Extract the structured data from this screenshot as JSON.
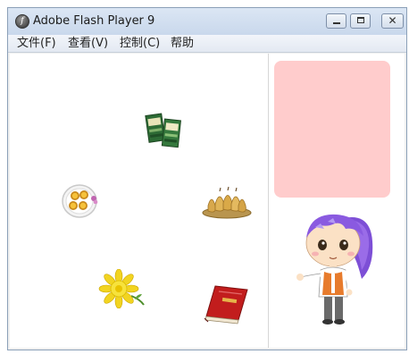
{
  "window": {
    "title": "Adobe Flash Player 9",
    "controls": {
      "minimize_icon": "minimize-icon",
      "maximize_icon": "maximize-icon",
      "close_icon": "close-icon"
    }
  },
  "menu": {
    "items": [
      {
        "label": "文件(F)"
      },
      {
        "label": "查看(V)"
      },
      {
        "label": "控制(C)"
      },
      {
        "label": "帮助"
      }
    ]
  },
  "stage": {
    "items": [
      {
        "name": "tea-packages",
        "icon": "tea-package-icon"
      },
      {
        "name": "tarts-plate",
        "icon": "egg-tart-plate-icon"
      },
      {
        "name": "pears-basket",
        "icon": "pear-basket-icon"
      },
      {
        "name": "chrysanthemum",
        "icon": "chrysanthemum-flower-icon"
      },
      {
        "name": "red-book",
        "icon": "red-book-icon"
      }
    ],
    "drop_zone_color": "#ffcccc",
    "character": "cartoon-girl-icon"
  },
  "colors": {
    "titlebar": "#c9d8ec",
    "stage_bg": "#ffffff",
    "drop_zone": "#ffcccc"
  }
}
